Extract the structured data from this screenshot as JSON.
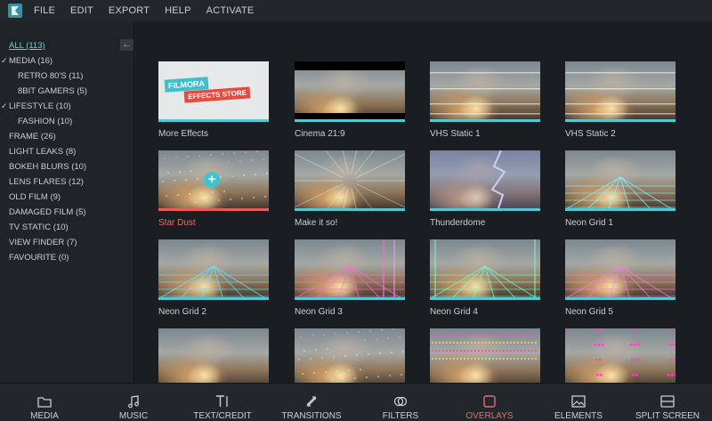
{
  "menu": [
    "FILE",
    "EDIT",
    "EXPORT",
    "HELP",
    "ACTIVATE"
  ],
  "sidebar": {
    "collapse_glyph": "←",
    "categories": [
      {
        "label": "ALL (113)",
        "level": 0,
        "active": true,
        "checked": false
      },
      {
        "label": "MEDIA (16)",
        "level": 0,
        "active": false,
        "checked": true
      },
      {
        "label": "RETRO 80'S (11)",
        "level": 1,
        "active": false,
        "checked": false
      },
      {
        "label": "8BIT GAMERS (5)",
        "level": 1,
        "active": false,
        "checked": false
      },
      {
        "label": "LIFESTYLE (10)",
        "level": 0,
        "active": false,
        "checked": true
      },
      {
        "label": "FASHION (10)",
        "level": 1,
        "active": false,
        "checked": false
      },
      {
        "label": "FRAME (26)",
        "level": 0,
        "active": false,
        "checked": false
      },
      {
        "label": "LIGHT LEAKS (8)",
        "level": 0,
        "active": false,
        "checked": false
      },
      {
        "label": "BOKEH BLURS (10)",
        "level": 0,
        "active": false,
        "checked": false
      },
      {
        "label": "LENS FLARES (12)",
        "level": 0,
        "active": false,
        "checked": false
      },
      {
        "label": "OLD FILM (9)",
        "level": 0,
        "active": false,
        "checked": false
      },
      {
        "label": "DAMAGED FILM (5)",
        "level": 0,
        "active": false,
        "checked": false
      },
      {
        "label": "TV STATIC (10)",
        "level": 0,
        "active": false,
        "checked": false
      },
      {
        "label": "VIEW FINDER (7)",
        "level": 0,
        "active": false,
        "checked": false
      },
      {
        "label": "FAVOURITE (0)",
        "level": 0,
        "active": false,
        "checked": false
      }
    ]
  },
  "store_banner": {
    "line1": "FILMORA",
    "line2": "EFFECTS STORE"
  },
  "plus_glyph": "+",
  "effects": [
    {
      "label": "More Effects",
      "kind": "store"
    },
    {
      "label": "Cinema 21:9",
      "kind": "cinema"
    },
    {
      "label": "VHS Static 1",
      "kind": "vhs1"
    },
    {
      "label": "VHS Static 2",
      "kind": "vhs2"
    },
    {
      "label": "Star Dust",
      "kind": "stardust",
      "selected": true
    },
    {
      "label": "Make it so!",
      "kind": "makeitso"
    },
    {
      "label": "Thunderdome",
      "kind": "thunder"
    },
    {
      "label": "Neon Grid 1",
      "kind": "grid1"
    },
    {
      "label": "Neon Grid 2",
      "kind": "grid2"
    },
    {
      "label": "Neon Grid 3",
      "kind": "grid3"
    },
    {
      "label": "Neon Grid 4",
      "kind": "grid4"
    },
    {
      "label": "Neon Grid 5",
      "kind": "grid5"
    },
    {
      "label": "",
      "kind": "plain"
    },
    {
      "label": "",
      "kind": "dots"
    },
    {
      "label": "",
      "kind": "pixels"
    },
    {
      "label": "",
      "kind": "pinkdots"
    }
  ],
  "bottom_tabs": [
    {
      "label": "MEDIA",
      "icon": "folder-icon",
      "active": false
    },
    {
      "label": "MUSIC",
      "icon": "music-note-icon",
      "active": false
    },
    {
      "label": "TEXT/CREDIT",
      "icon": "text-icon",
      "active": false
    },
    {
      "label": "TRANSITIONS",
      "icon": "transitions-icon",
      "active": false
    },
    {
      "label": "FILTERS",
      "icon": "filters-icon",
      "active": false
    },
    {
      "label": "OVERLAYS",
      "icon": "overlays-icon",
      "active": true
    },
    {
      "label": "ELEMENTS",
      "icon": "elements-icon",
      "active": false
    },
    {
      "label": "SPLIT SCREEN",
      "icon": "split-screen-icon",
      "active": false
    }
  ],
  "colors": {
    "accent": "#52c8d2",
    "selected": "#e95b5b",
    "background": "#1d2125"
  }
}
